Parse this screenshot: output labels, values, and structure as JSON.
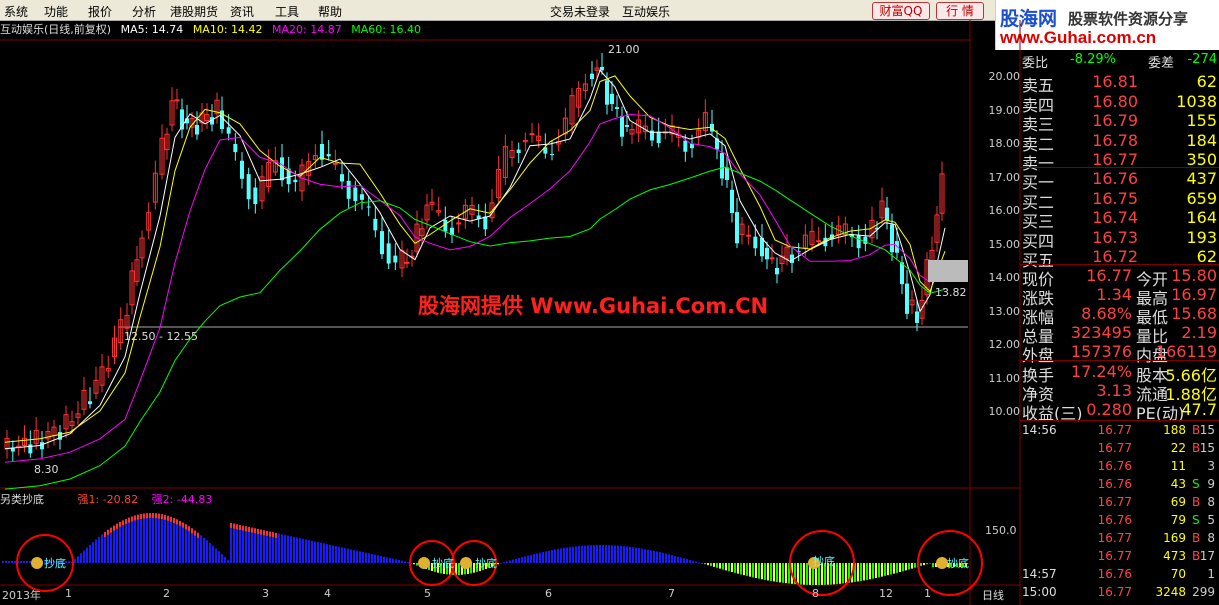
{
  "menu": {
    "items": [
      "系统",
      "功能",
      "报价",
      "分析",
      "港股期货",
      "资讯",
      "工具",
      "帮助"
    ],
    "status_left": "交易未登录",
    "status_right": "互动娱乐",
    "btn_qq": "财富QQ",
    "btn_quote": "行 情"
  },
  "logo": {
    "line1": "股海网",
    "line1b": "股票软件资源分享",
    "line2": "www.Guhai.com.cn"
  },
  "chart_header": {
    "name": "互动娱乐(日线,前复权)",
    "ma5": "MA5: 14.74",
    "ma10": "MA10: 14.42",
    "ma20": "MA20: 14.87",
    "ma60": "MA60: 16.40"
  },
  "price_axis": [
    "20.00",
    "19.00",
    "18.00",
    "17.00",
    "16.00",
    "15.00",
    "14.00",
    "13.00",
    "12.00",
    "11.00",
    "10.00"
  ],
  "annotations": {
    "high": "21.00",
    "low": "8.30",
    "range": "12.50 - 12.55",
    "cursor": "13.82"
  },
  "watermark": "股海网提供 Www.Guhai.Com.CN",
  "indicator": {
    "name": "另类抄底",
    "s1": "强1: -20.82",
    "s2": "强2: -44.83",
    "scale": "150.0",
    "bottom_label": "抄底"
  },
  "xaxis": [
    "2013年",
    "1",
    "2",
    "3",
    "4",
    "5",
    "6",
    "7",
    "8",
    "12",
    "1"
  ],
  "period_label": "日线",
  "quote": {
    "top_row": {
      "lbl": "委比",
      "val": "-8.29%",
      "lbl2": "委差",
      "val2": "-274"
    },
    "asks": [
      {
        "lbl": "卖五",
        "px": "16.81",
        "vol": "62"
      },
      {
        "lbl": "卖四",
        "px": "16.80",
        "vol": "1038"
      },
      {
        "lbl": "卖三",
        "px": "16.79",
        "vol": "155"
      },
      {
        "lbl": "卖二",
        "px": "16.78",
        "vol": "184"
      },
      {
        "lbl": "卖一",
        "px": "16.77",
        "vol": "350"
      }
    ],
    "bids": [
      {
        "lbl": "买一",
        "px": "16.76",
        "vol": "437"
      },
      {
        "lbl": "买二",
        "px": "16.75",
        "vol": "659"
      },
      {
        "lbl": "买三",
        "px": "16.74",
        "vol": "164"
      },
      {
        "lbl": "买四",
        "px": "16.73",
        "vol": "193"
      },
      {
        "lbl": "买五",
        "px": "16.72",
        "vol": "62"
      }
    ],
    "stats": [
      {
        "a": "现价",
        "av": "16.77",
        "b": "今开",
        "bv": "15.80"
      },
      {
        "a": "涨跌",
        "av": "1.34",
        "b": "最高",
        "bv": "16.97"
      },
      {
        "a": "涨幅",
        "av": "8.68%",
        "b": "最低",
        "bv": "15.68"
      },
      {
        "a": "总量",
        "av": "323495",
        "b": "量比",
        "bv": "2.19"
      },
      {
        "a": "外盘",
        "av": "157376",
        "b": "内盘",
        "bv": "166119"
      }
    ],
    "stats2": [
      {
        "a": "换手",
        "av": "17.24%",
        "b": "股本",
        "bv": "5.66亿"
      },
      {
        "a": "净资",
        "av": "3.13",
        "b": "流通",
        "bv": "1.88亿"
      },
      {
        "a": "收益(三)",
        "av": "0.280",
        "b": "PE(动)",
        "bv": "47.7"
      }
    ],
    "ticks": [
      {
        "t": "14:56",
        "p": "16.77",
        "v": "188",
        "d": "B",
        "n": "15"
      },
      {
        "t": "",
        "p": "16.77",
        "v": "22",
        "d": "B",
        "n": "15"
      },
      {
        "t": "",
        "p": "16.76",
        "v": "11",
        "d": "",
        "n": "3"
      },
      {
        "t": "",
        "p": "16.76",
        "v": "43",
        "d": "S",
        "n": "9"
      },
      {
        "t": "",
        "p": "16.77",
        "v": "69",
        "d": "B",
        "n": "8"
      },
      {
        "t": "",
        "p": "16.76",
        "v": "79",
        "d": "S",
        "n": "5"
      },
      {
        "t": "",
        "p": "16.77",
        "v": "169",
        "d": "B",
        "n": "8"
      },
      {
        "t": "",
        "p": "16.77",
        "v": "473",
        "d": "B",
        "n": "17"
      },
      {
        "t": "14:57",
        "p": "16.76",
        "v": "70",
        "d": "",
        "n": "1"
      },
      {
        "t": "15:00",
        "p": "16.77",
        "v": "3248",
        "d": "",
        "n": "299"
      }
    ]
  },
  "colors": {
    "up": "#ff3232",
    "down": "#54ffff",
    "ma5": "#ffffff",
    "ma10": "#ffff00",
    "ma20": "#ff00ff",
    "ma60": "#00ff00",
    "grid": "#800000"
  }
}
